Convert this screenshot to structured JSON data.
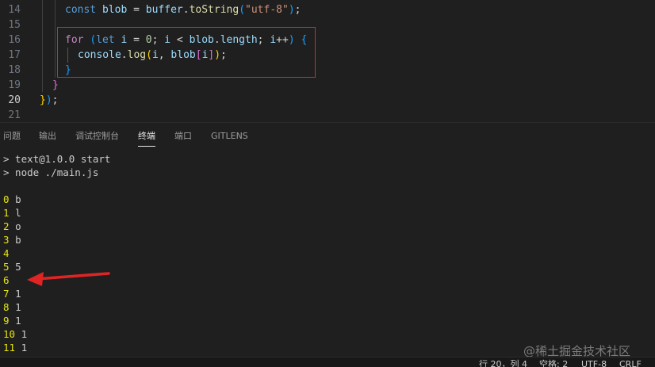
{
  "editor": {
    "line_numbers": [
      "14",
      "15",
      "16",
      "17",
      "18",
      "19",
      "20",
      "21"
    ],
    "line14": {
      "kw": "const",
      "name": "blob",
      "eq": " = ",
      "obj": "buffer",
      "dot": ".",
      "fn": "toString",
      "open": "(",
      "str": "\"utf-8\"",
      "close": ")",
      "semi": ";"
    },
    "line16": {
      "kw": "for",
      "sp": " ",
      "open": "(",
      "let": "let",
      "sp2": " ",
      "i": "i",
      "eq": " = ",
      "zero": "0",
      "semi1": "; ",
      "i2": "i",
      "lt": " < ",
      "blob": "blob",
      "dot": ".",
      "len": "length",
      "semi2": "; ",
      "i3": "i",
      "inc": "++",
      "close": ")",
      "brace": " {"
    },
    "line17": {
      "obj": "console",
      "dot": ".",
      "fn": "log",
      "open": "(",
      "i": "i",
      "comma": ", ",
      "blob": "blob",
      "bopen": "[",
      "idx": "i",
      "bclose": "]",
      "close": ")",
      "semi": ";"
    },
    "line18": {
      "brace": "}"
    },
    "line19": {
      "brace": "}"
    },
    "line20": {
      "brace": "}",
      "paren": ")",
      "semi": ";"
    }
  },
  "panel": {
    "tabs": [
      "问题",
      "输出",
      "调试控制台",
      "终端",
      "端口",
      "GITLENS"
    ],
    "active_tab": "终端"
  },
  "terminal": {
    "prompt_lines": [
      "> text@1.0.0 start",
      "> node ./main.js"
    ],
    "output": [
      {
        "i": "0",
        "v": "b"
      },
      {
        "i": "1",
        "v": "l"
      },
      {
        "i": "2",
        "v": "o"
      },
      {
        "i": "3",
        "v": "b"
      },
      {
        "i": "4",
        "v": ""
      },
      {
        "i": "5",
        "v": "5"
      },
      {
        "i": "6",
        "v": ""
      },
      {
        "i": "7",
        "v": "1"
      },
      {
        "i": "8",
        "v": "1"
      },
      {
        "i": "9",
        "v": "1"
      },
      {
        "i": "10",
        "v": "1"
      },
      {
        "i": "11",
        "v": "1"
      }
    ]
  },
  "status_bar": {
    "position": "行 20，列 4",
    "spaces": "空格: 2",
    "encoding": "UTF-8",
    "eol": "CRLF"
  },
  "watermark": "@稀土掘金技术社区",
  "colors": {
    "highlight_box": "#e02424",
    "arrow": "#e02424",
    "terminal_index": "#e5e510"
  }
}
